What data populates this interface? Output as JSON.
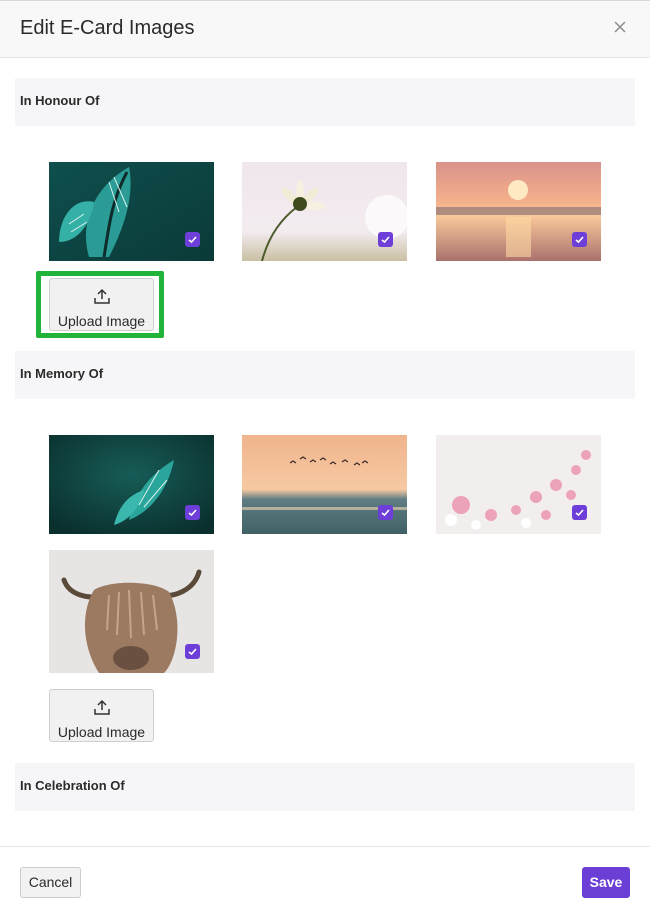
{
  "modal": {
    "title": "Edit E-Card Images",
    "close_icon": "close-icon"
  },
  "sections": [
    {
      "title": "In Honour Of",
      "images": [
        {
          "name": "butterfly-teal",
          "selected": true
        },
        {
          "name": "daisy-soft-pink",
          "selected": true
        },
        {
          "name": "sunset-sea",
          "selected": true
        }
      ],
      "upload_label": "Upload Image"
    },
    {
      "title": "In Memory Of",
      "images": [
        {
          "name": "butterfly-dark-teal",
          "selected": true
        },
        {
          "name": "birds-over-sea",
          "selected": true
        },
        {
          "name": "pink-cosmos-flowers",
          "selected": true
        },
        {
          "name": "highland-cow",
          "selected": true
        }
      ],
      "upload_label": "Upload Image"
    },
    {
      "title": "In Celebration Of",
      "images": []
    }
  ],
  "footer": {
    "cancel_label": "Cancel",
    "save_label": "Save"
  },
  "colors": {
    "accent": "#6b3fd6",
    "highlight": "#22b33a"
  }
}
